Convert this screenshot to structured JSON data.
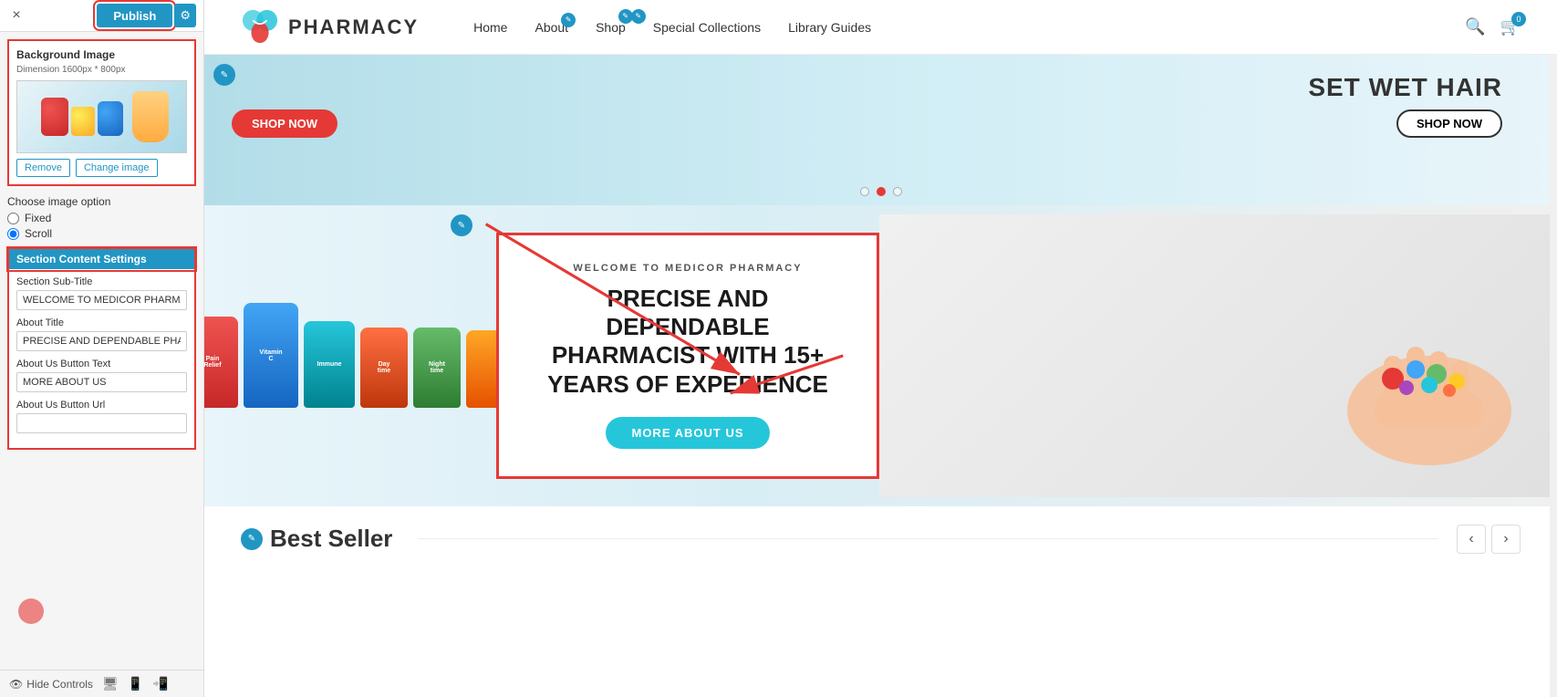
{
  "panel": {
    "close_label": "×",
    "publish_label": "Publish",
    "gear_label": "⚙",
    "bg_image": {
      "title": "Background Image",
      "dimension": "Dimension 1600px * 800px",
      "remove_btn": "Remove",
      "change_btn": "Change image"
    },
    "image_option": {
      "label": "Choose image option",
      "fixed_label": "Fixed",
      "scroll_label": "Scroll"
    },
    "section_content": {
      "header": "Section Content Settings",
      "subtitle_label": "Section Sub-Title",
      "subtitle_value": "WELCOME TO MEDICOR PHARMACY",
      "about_title_label": "About Title",
      "about_title_value": "PRECISE AND DEPENDABLE PHARMACI",
      "button_text_label": "About Us Button Text",
      "button_text_value": "MORE ABOUT US",
      "button_url_label": "About Us Button Url",
      "button_url_value": ""
    },
    "footer": {
      "hide_label": "Hide Controls"
    }
  },
  "nav": {
    "logo_text": "PHARMACY",
    "links": [
      {
        "label": "Home",
        "editable": false
      },
      {
        "label": "About",
        "editable": true
      },
      {
        "label": "Shop",
        "editable": true
      },
      {
        "label": "Special Collections",
        "editable": true
      },
      {
        "label": "Library Guides",
        "editable": false
      }
    ]
  },
  "hero": {
    "title": "SET WET HAIR",
    "shop_btn": "SHOP NOW",
    "shop_btn_left": "SHOP NOW",
    "dots": [
      false,
      true,
      false
    ]
  },
  "about": {
    "subtitle": "WELCOME TO MEDICOR PHARMACY",
    "title": "PRECISE AND DEPENDABLE PHARMACIST\nWITH 15+ YEARS OF EXPERIENCE",
    "button": "MORE ABOUT US",
    "edit_icon": "✎"
  },
  "best_seller": {
    "title": "Best Seller",
    "icon": "✎",
    "prev_btn": "‹",
    "next_btn": "›"
  }
}
